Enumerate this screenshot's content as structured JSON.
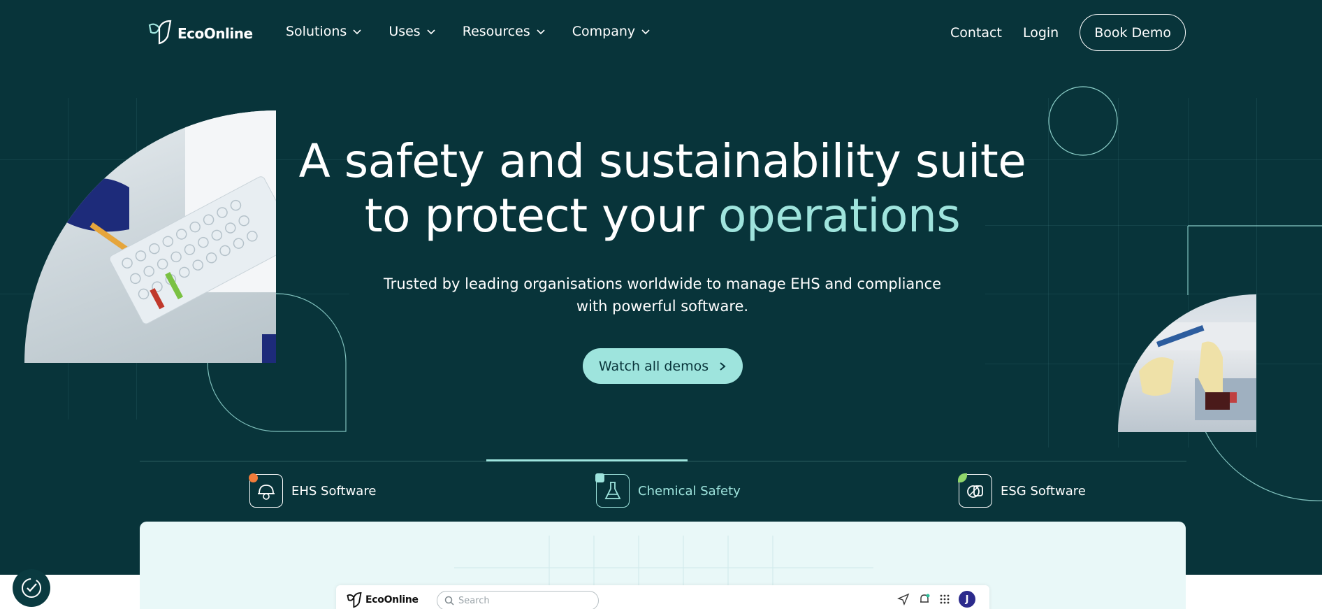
{
  "brand": {
    "name": "EcoOnline"
  },
  "nav": {
    "menu": [
      {
        "label": "Solutions"
      },
      {
        "label": "Uses"
      },
      {
        "label": "Resources"
      },
      {
        "label": "Company"
      }
    ],
    "contact": "Contact",
    "login": "Login",
    "book_demo": "Book Demo"
  },
  "hero": {
    "title_line1": "A safety and sustainability suite",
    "title_line2_prefix": "to protect your ",
    "title_line2_accent": "operations",
    "subtitle_line1": "Trusted by leading organisations worldwide to manage EHS and compliance",
    "subtitle_line2": "with powerful software.",
    "cta": "Watch all demos"
  },
  "tabs": [
    {
      "label": "EHS Software",
      "icon": "hard-hat-icon",
      "dot_color": "#f27c3a",
      "active": false
    },
    {
      "label": "Chemical Safety",
      "icon": "flask-icon",
      "dot_color": "#9ee4dd",
      "active": true
    },
    {
      "label": "ESG Software",
      "icon": "leaf-icon",
      "dot_color": "#8fd66b",
      "active": false
    }
  ],
  "app_preview": {
    "brand": "EcoOnline",
    "search_placeholder": "Search",
    "avatar_initial": "J"
  },
  "colors": {
    "background": "#08343a",
    "accent": "#9ee4dd"
  }
}
